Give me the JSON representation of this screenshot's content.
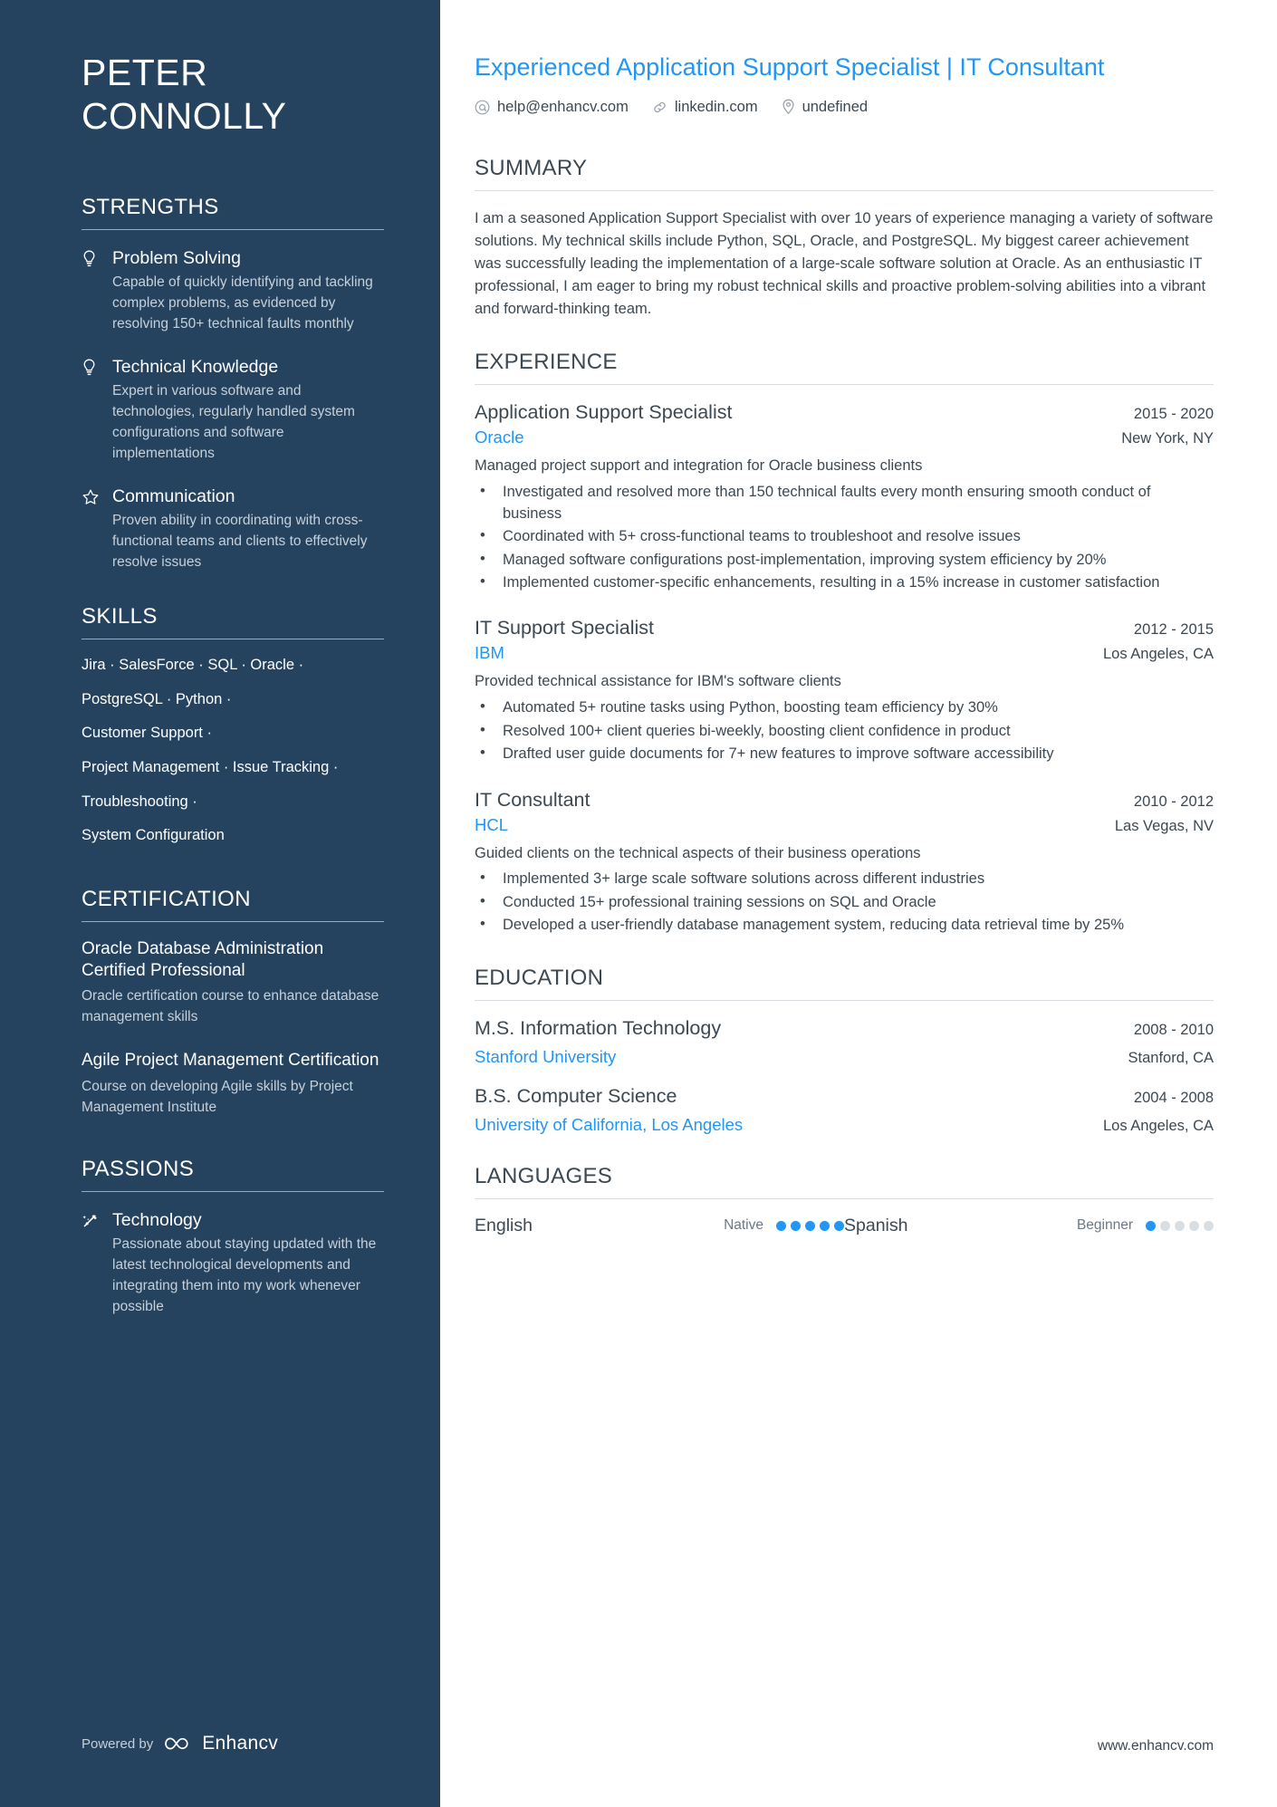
{
  "sidebar": {
    "name": "PETER\nCONNOLLY",
    "strengths_heading": "STRENGTHS",
    "strengths": [
      {
        "icon": "lightbulb-icon",
        "title": "Problem Solving",
        "desc": "Capable of quickly identifying and tackling complex problems, as evidenced by resolving 150+ technical faults monthly"
      },
      {
        "icon": "lightbulb-icon",
        "title": "Technical Knowledge",
        "desc": "Expert in various software and technologies, regularly handled system configurations and software implementations"
      },
      {
        "icon": "star-outline-icon",
        "title": "Communication",
        "desc": "Proven ability in coordinating with cross-functional teams and clients to effectively resolve issues"
      }
    ],
    "skills_heading": "SKILLS",
    "skill_lines": [
      "Jira · SalesForce · SQL · Oracle ·",
      "PostgreSQL · Python ·",
      "Customer Support ·",
      "Project Management · Issue Tracking ·",
      "Troubleshooting ·",
      "System Configuration"
    ],
    "certification_heading": "CERTIFICATION",
    "certifications": [
      {
        "title": "Oracle Database Administration Certified Professional",
        "desc": "Oracle certification course to enhance database management skills"
      },
      {
        "title": "Agile Project Management Certification",
        "desc": "Course on developing Agile skills by Project Management Institute"
      }
    ],
    "passions_heading": "PASSIONS",
    "passions": [
      {
        "icon": "shooting-star-icon",
        "title": "Technology",
        "desc": "Passionate about staying updated with the latest technological developments and integrating them into my work whenever possible"
      }
    ],
    "powered_by_label": "Powered by",
    "brand_name": "Enhancv"
  },
  "main": {
    "job_title": "Experienced Application Support Specialist | IT Consultant",
    "contacts": [
      {
        "icon": "at-sign-icon",
        "value": "help@enhancv.com"
      },
      {
        "icon": "link-icon",
        "value": "linkedin.com"
      },
      {
        "icon": "location-pin-icon",
        "value": "undefined"
      }
    ],
    "summary_heading": "SUMMARY",
    "summary_text": "I am a seasoned Application Support Specialist with over 10 years of experience managing a variety of software solutions. My technical skills include Python, SQL, Oracle, and PostgreSQL. My biggest career achievement was successfully leading the implementation of a large-scale software solution at Oracle. As an enthusiastic IT professional, I am eager to bring my robust technical skills and proactive problem-solving abilities into a vibrant and forward-thinking team.",
    "experience_heading": "EXPERIENCE",
    "experience": [
      {
        "role": "Application Support Specialist",
        "date": "2015 - 2020",
        "company": "Oracle",
        "location": "New York, NY",
        "subtitle": "Managed project support and integration for Oracle business clients",
        "bullets": [
          "Investigated and resolved more than 150 technical faults every month ensuring smooth conduct of business",
          "Coordinated with 5+ cross-functional teams to troubleshoot and resolve issues",
          "Managed software configurations post-implementation, improving system efficiency by 20%",
          "Implemented customer-specific enhancements, resulting in a 15% increase in customer satisfaction"
        ]
      },
      {
        "role": "IT Support Specialist",
        "date": "2012 - 2015",
        "company": "IBM",
        "location": "Los Angeles, CA",
        "subtitle": "Provided technical assistance for IBM's software clients",
        "bullets": [
          "Automated 5+ routine tasks using Python, boosting team efficiency by 30%",
          "Resolved 100+ client queries bi-weekly, boosting client confidence in product",
          "Drafted user guide documents for 7+ new features to improve software accessibility"
        ]
      },
      {
        "role": "IT Consultant",
        "date": "2010 - 2012",
        "company": "HCL",
        "location": "Las Vegas, NV",
        "subtitle": "Guided clients on the technical aspects of their business operations",
        "bullets": [
          "Implemented 3+ large scale software solutions across different industries",
          "Conducted 15+ professional training sessions on SQL and Oracle",
          "Developed a user-friendly database management system, reducing data retrieval time by 25%"
        ]
      }
    ],
    "education_heading": "EDUCATION",
    "education": [
      {
        "degree": "M.S. Information Technology",
        "date": "2008 - 2010",
        "school": "Stanford University",
        "location": "Stanford, CA"
      },
      {
        "degree": "B.S. Computer Science",
        "date": "2004 - 2008",
        "school": "University of California, Los Angeles",
        "location": "Los Angeles, CA"
      }
    ],
    "languages_heading": "LANGUAGES",
    "languages": [
      {
        "name": "English",
        "level": "Native",
        "filled": 5,
        "total": 5
      },
      {
        "name": "Spanish",
        "level": "Beginner",
        "filled": 1,
        "total": 5
      }
    ],
    "site_url": "www.enhancv.com"
  },
  "colors": {
    "sidebar_bg": "#25435f",
    "accent_blue": "#2196f3",
    "body_text": "#3c4852",
    "muted_text": "#c7d0d9"
  }
}
